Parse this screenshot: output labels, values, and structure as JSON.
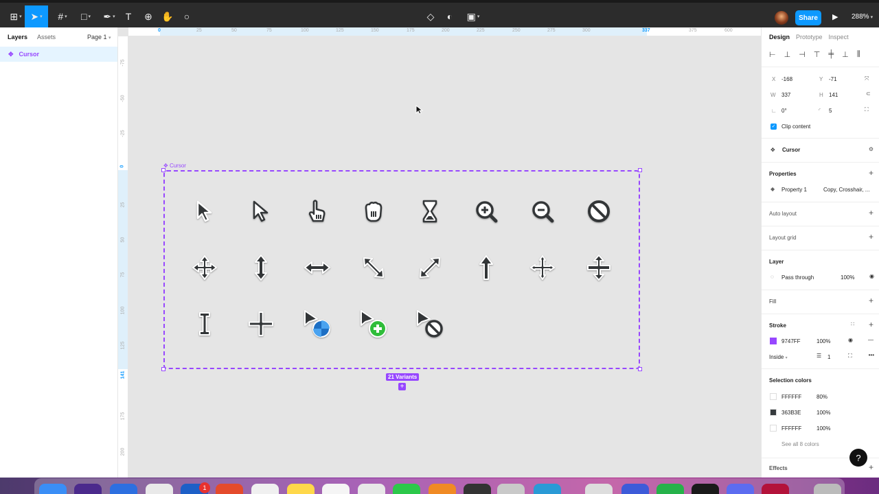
{
  "toolbar": {
    "share_label": "Share",
    "zoom_label": "288%"
  },
  "layers_panel": {
    "tabs": [
      "Layers",
      "Assets"
    ],
    "page_label": "Page 1",
    "layer_name": "Cursor"
  },
  "rulers": {
    "top": [
      "0",
      "25",
      "50",
      "75",
      "100",
      "125",
      "150",
      "175",
      "200",
      "225",
      "250",
      "275",
      "300",
      "337",
      "375",
      "600"
    ],
    "left": [
      "-75",
      "-50",
      "-25",
      "0",
      "25",
      "50",
      "75",
      "100",
      "125",
      "141",
      "175",
      "200"
    ]
  },
  "canvas": {
    "frame_label": "Cursor",
    "variants_label": "21 Variants",
    "add_variant_label": "+",
    "cursor_icons": [
      "arrow-black-icon",
      "arrow-white-icon",
      "hand-pointer-icon",
      "hand-grab-icon",
      "hourglass-icon",
      "zoom-in-icon",
      "zoom-out-icon",
      "not-allowed-icon",
      "move-icon",
      "resize-vertical-icon",
      "resize-horizontal-icon",
      "resize-nwse-icon",
      "resize-nesw-icon",
      "up-arrow-icon",
      "crosshair-arrows-icon",
      "row-resize-icon",
      "text-ibeam-icon",
      "crosshair-icon",
      "arrow-busy-icon",
      "arrow-copy-icon",
      "arrow-no-drop-icon"
    ]
  },
  "design_panel": {
    "tabs": [
      "Design",
      "Prototype",
      "Inspect"
    ],
    "x_label": "X",
    "x_value": "-168",
    "y_label": "Y",
    "y_value": "-71",
    "w_label": "W",
    "w_value": "337",
    "h_label": "H",
    "h_value": "141",
    "rotation_value": "0°",
    "radius_value": "5",
    "clip_content": "Clip content",
    "component_name": "Cursor",
    "properties_title": "Properties",
    "property_name": "Property 1",
    "property_value": "Copy, Crosshair, ...",
    "auto_layout": "Auto layout",
    "layout_grid": "Layout grid",
    "layer_title": "Layer",
    "blend_mode": "Pass through",
    "layer_opacity": "100%",
    "fill_title": "Fill",
    "stroke_title": "Stroke",
    "stroke_color": "9747FF",
    "stroke_opacity": "100%",
    "stroke_position": "Inside",
    "stroke_weight": "1",
    "selection_colors_title": "Selection colors",
    "selection_colors": [
      {
        "hex": "FFFFFF",
        "opacity": "80%",
        "swatch": "#ffffff"
      },
      {
        "hex": "363B3E",
        "opacity": "100%",
        "swatch": "#363b3e"
      },
      {
        "hex": "FFFFFF",
        "opacity": "100%",
        "swatch": "#ffffff"
      }
    ],
    "see_all": "See all 8 colors",
    "effects_title": "Effects"
  },
  "help_label": "?",
  "dock_badge": "1"
}
